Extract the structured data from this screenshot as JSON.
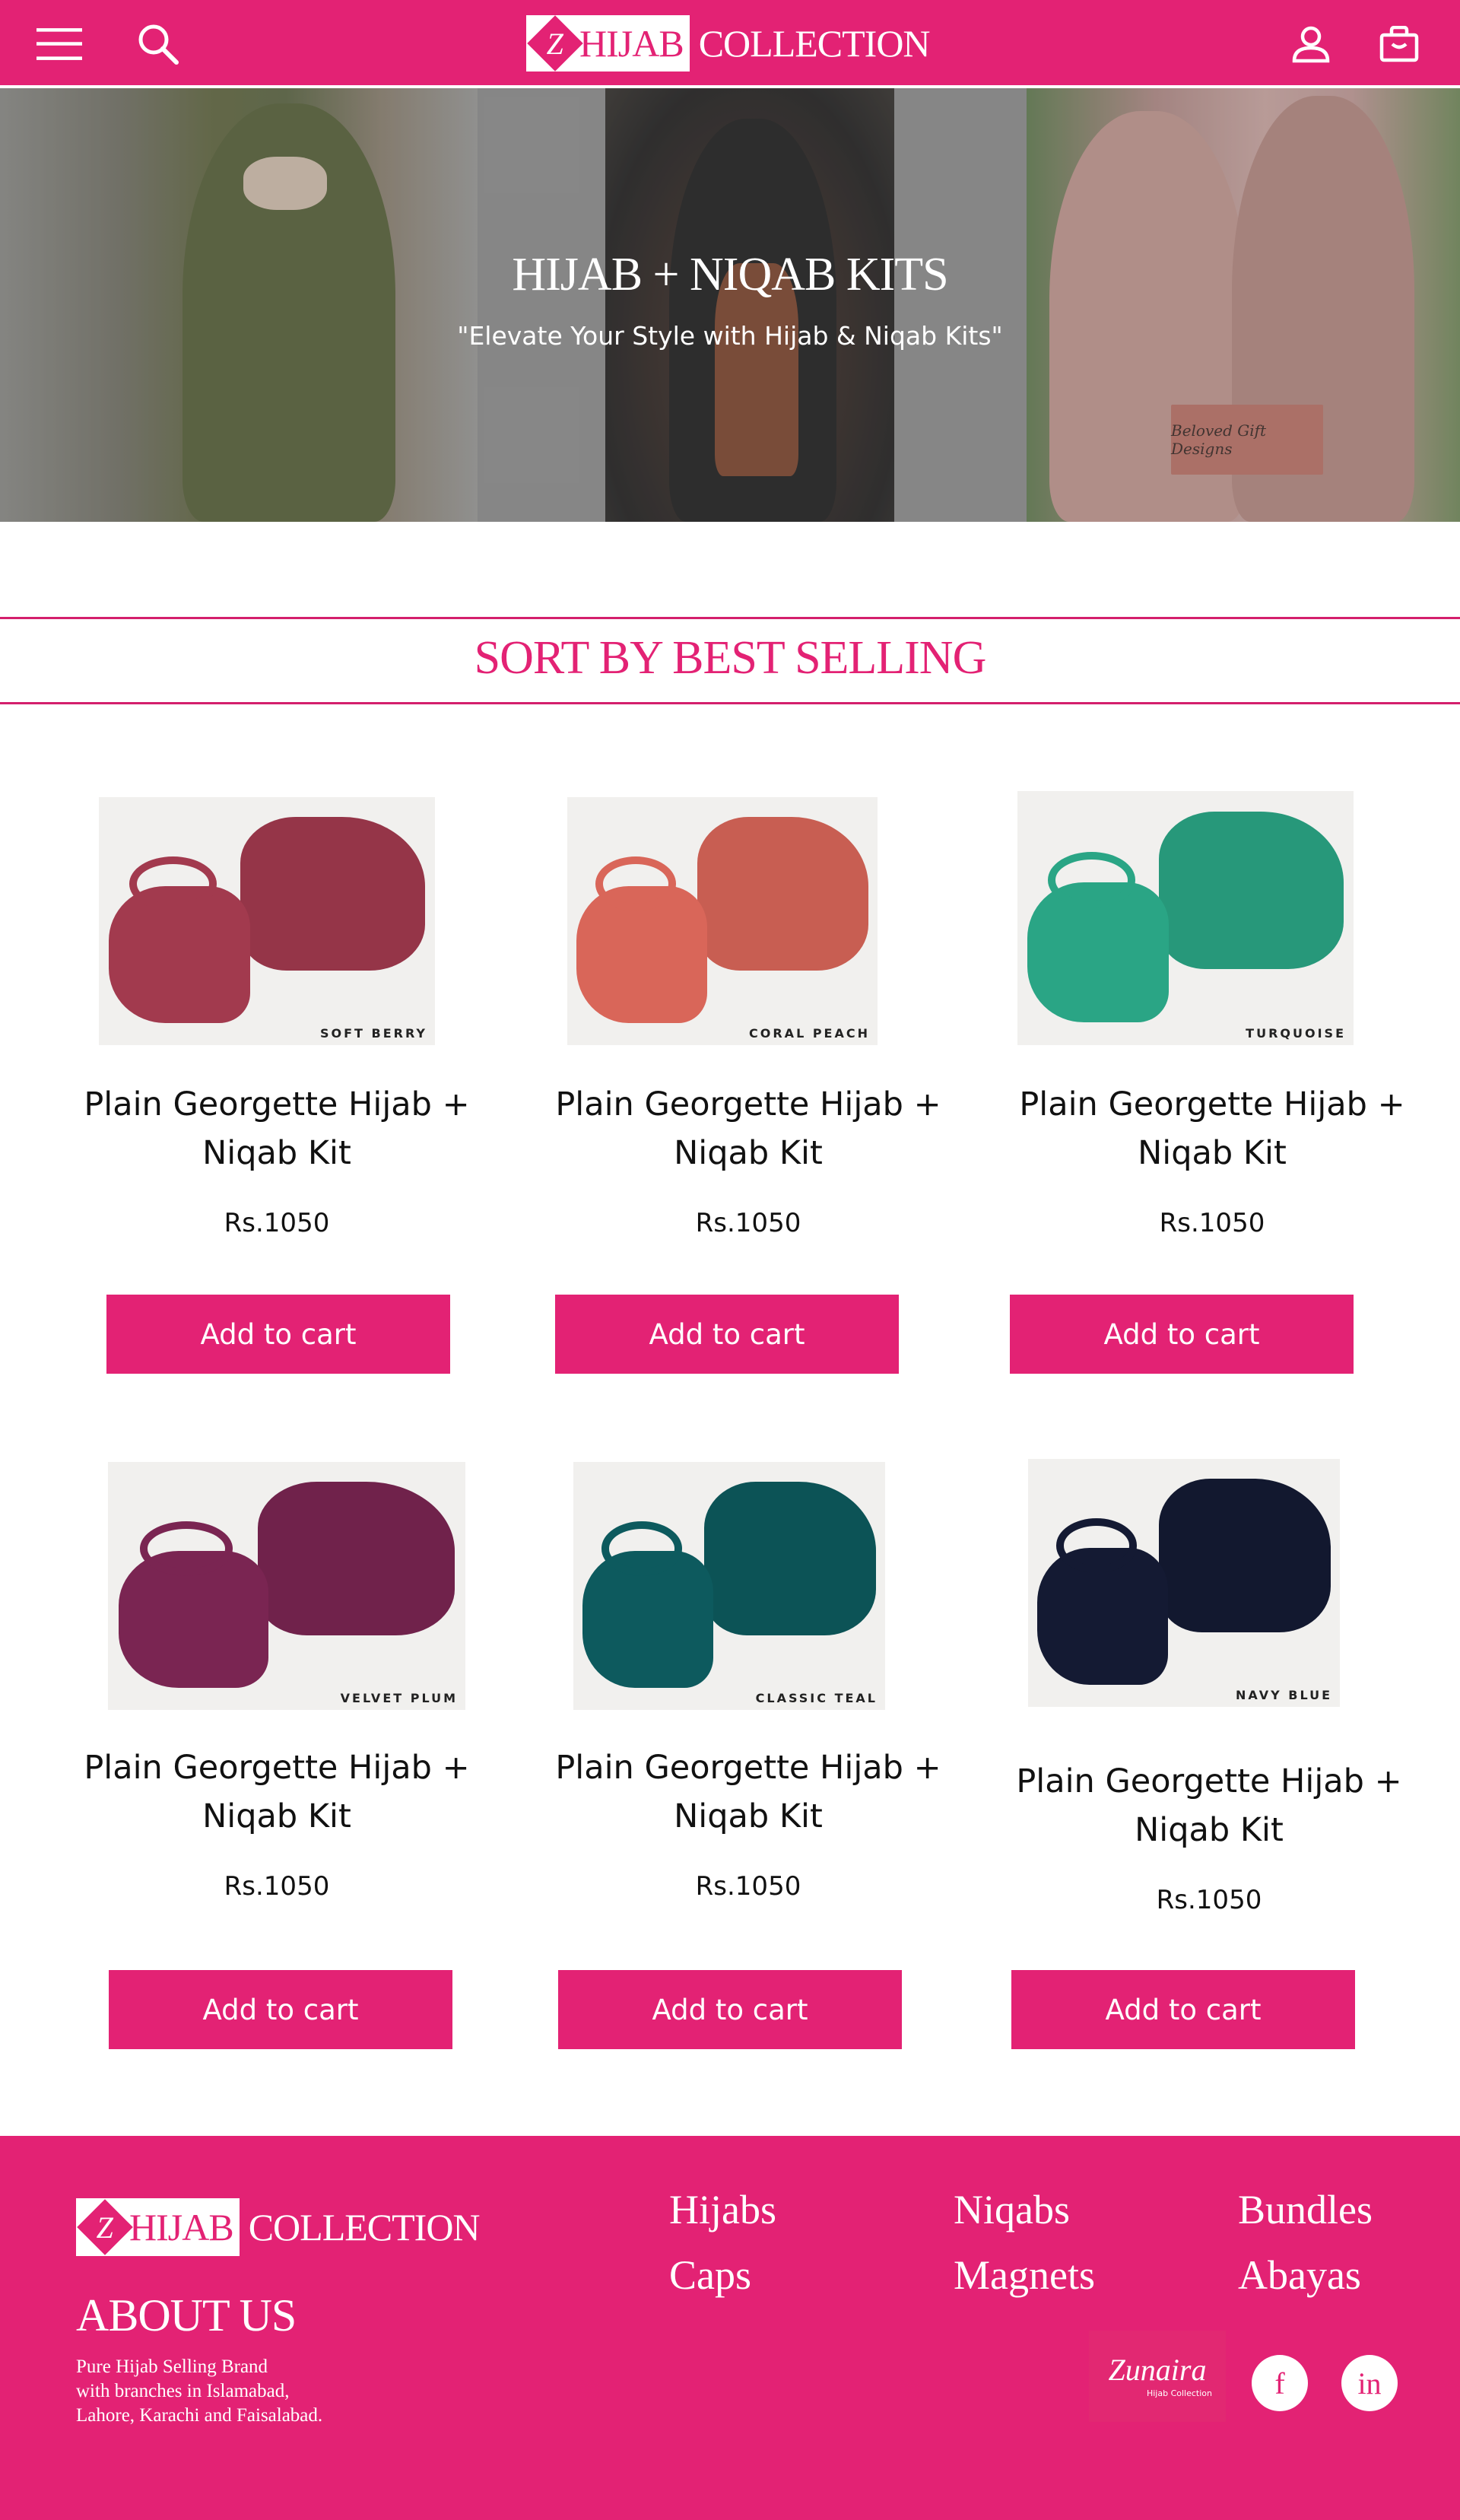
{
  "header": {
    "menu_icon": "hamburger-menu-icon",
    "search_icon": "search-icon",
    "account_icon": "user-icon",
    "cart_icon": "shopping-bag-icon",
    "logo": {
      "mark": "Z",
      "hijab": "HIJAB",
      "collection": "COLLECTION"
    },
    "brand_color": "#e32274"
  },
  "hero": {
    "title": "HIJAB + NIQAB KITS",
    "subtitle": "\"Elevate Your Style with Hijab & Niqab Kits\"",
    "badge_text": "Beloved Gift Designs"
  },
  "sort": {
    "label": "SORT BY BEST SELLING"
  },
  "products": [
    {
      "name": "Plain Georgette Hijab + Niqab Kit",
      "price": "Rs.1050",
      "button": "Add to cart",
      "image_label": "SOFT BERRY",
      "color": "#a23a4e"
    },
    {
      "name": "Plain Georgette Hijab + Niqab Kit",
      "price": "Rs.1050",
      "button": "Add to cart",
      "image_label": "CORAL PEACH",
      "color": "#d96659"
    },
    {
      "name": "Plain Georgette Hijab + Niqab Kit",
      "price": "Rs.1050",
      "button": "Add to cart",
      "image_label": "TURQUOISE",
      "color": "#2aa585"
    },
    {
      "name": "Plain Georgette Hijab + Niqab Kit",
      "price": "Rs.1050",
      "button": "Add to cart",
      "image_label": "VELVET PLUM",
      "color": "#7a2552"
    },
    {
      "name": "Plain Georgette Hijab + Niqab Kit",
      "price": "Rs.1050",
      "button": "Add to cart",
      "image_label": "CLASSIC TEAL",
      "color": "#0d5a5e"
    },
    {
      "name": "Plain Georgette Hijab + Niqab Kit",
      "price": "Rs.1050",
      "button": "Add to cart",
      "image_label": "NAVY BLUE",
      "color": "#141a33"
    }
  ],
  "footer": {
    "logo": {
      "mark": "Z",
      "hijab": "HIJAB",
      "collection": "COLLECTION"
    },
    "about_title": "ABOUT US",
    "about_lines": [
      "Pure Hijab Selling Brand",
      "with branches in Islamabad,",
      "Lahore, Karachi and Faisalabad."
    ],
    "links": [
      "Hijabs",
      "Niqabs",
      "Bundles",
      "Caps",
      "Magnets",
      "Abayas"
    ],
    "partner": {
      "name": "Zunaira",
      "sub": "Hijab Collection"
    },
    "social": {
      "facebook": "f",
      "linkedin": "in"
    }
  }
}
